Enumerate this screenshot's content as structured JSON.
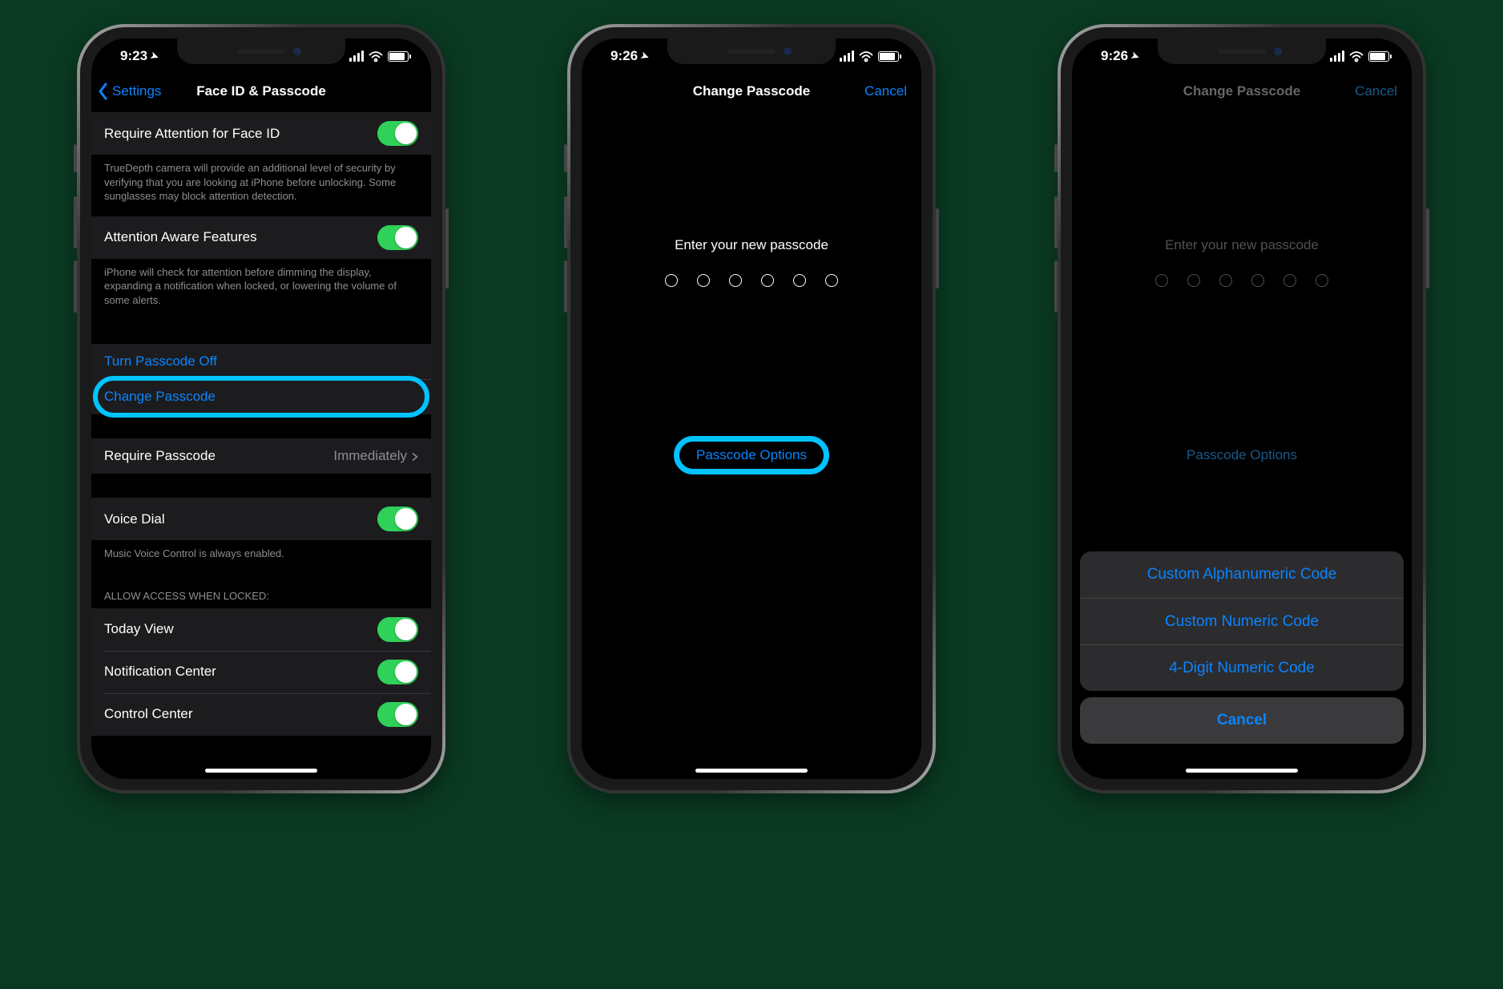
{
  "screen1": {
    "status": {
      "time": "9:23"
    },
    "nav": {
      "back": "Settings",
      "title": "Face ID & Passcode"
    },
    "attention": {
      "require_label": "Require Attention for Face ID",
      "require_footer": "TrueDepth camera will provide an additional level of security by verifying that you are looking at iPhone before unlocking. Some sunglasses may block attention detection.",
      "aware_label": "Attention Aware Features",
      "aware_footer": "iPhone will check for attention before dimming the display, expanding a notification when locked, or lowering the volume of some alerts."
    },
    "passcode": {
      "turn_off": "Turn Passcode Off",
      "change": "Change Passcode",
      "require_label": "Require Passcode",
      "require_value": "Immediately"
    },
    "voice": {
      "label": "Voice Dial",
      "footer": "Music Voice Control is always enabled."
    },
    "locked": {
      "header": "Allow Access When Locked:",
      "today": "Today View",
      "notif": "Notification Center",
      "control": "Control Center"
    }
  },
  "screen2": {
    "status": {
      "time": "9:26"
    },
    "nav": {
      "title": "Change Passcode",
      "cancel": "Cancel"
    },
    "prompt": "Enter your new passcode",
    "options": "Passcode Options"
  },
  "screen3": {
    "status": {
      "time": "9:26"
    },
    "nav": {
      "title": "Change Passcode",
      "cancel": "Cancel"
    },
    "prompt": "Enter your new passcode",
    "options": "Passcode Options",
    "sheet": {
      "alpha": "Custom Alphanumeric Code",
      "numeric": "Custom Numeric Code",
      "four": "4-Digit Numeric Code",
      "cancel": "Cancel"
    }
  }
}
